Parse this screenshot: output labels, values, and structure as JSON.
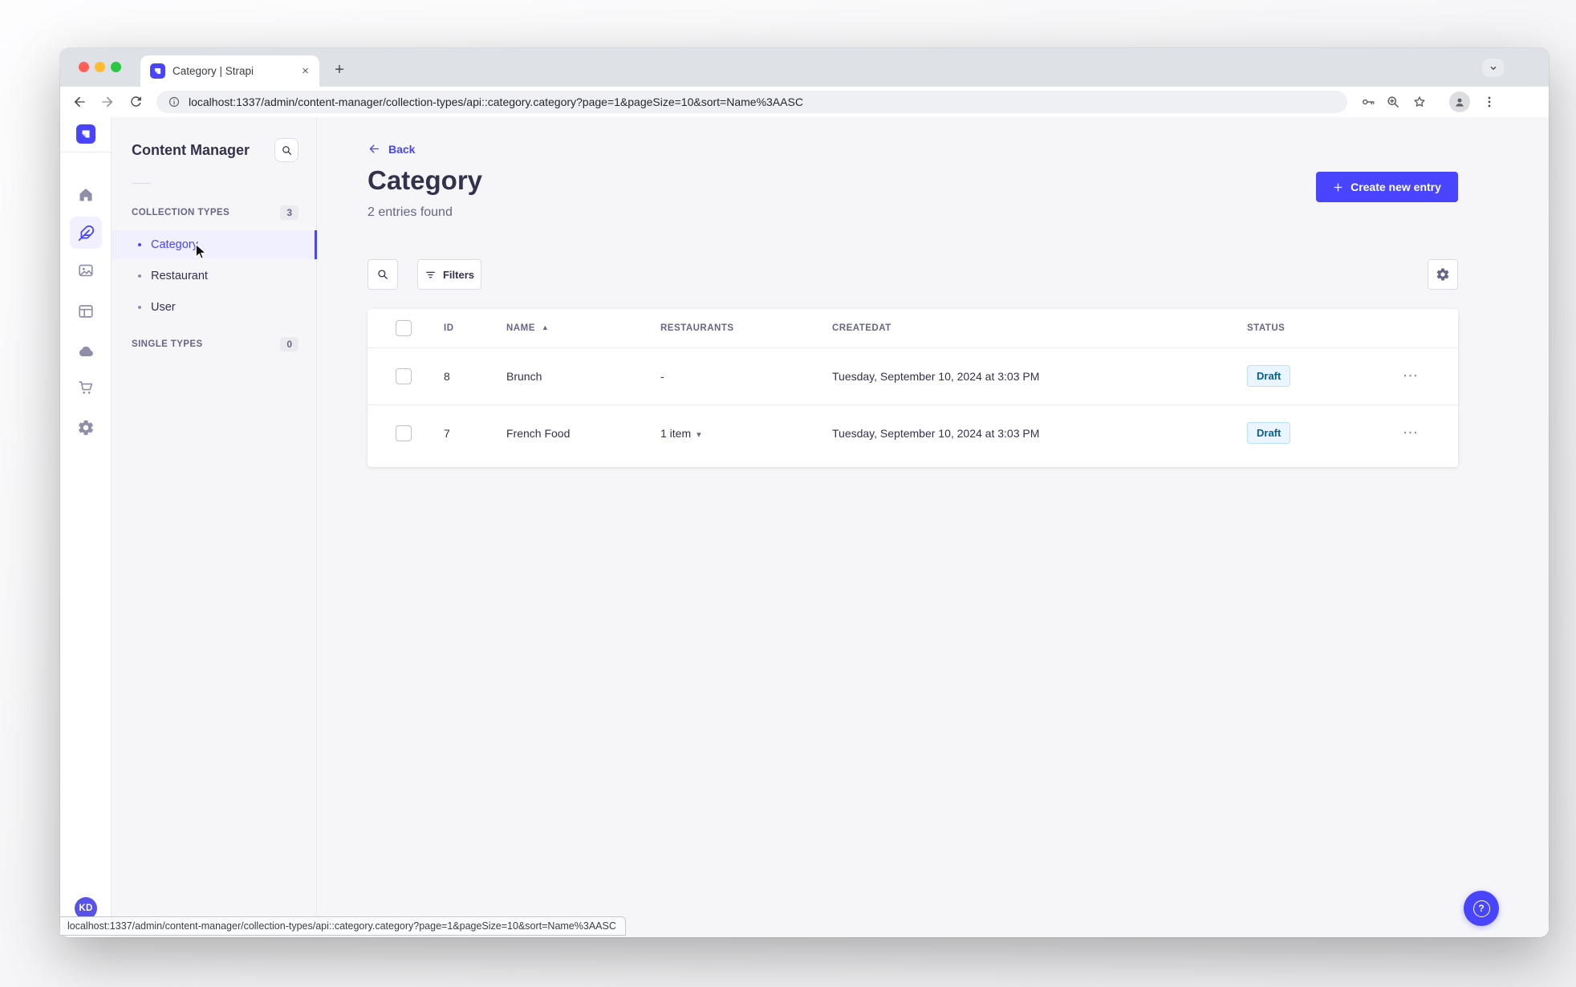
{
  "browser": {
    "tab_title": "Category | Strapi",
    "url": "localhost:1337/admin/content-manager/collection-types/api::category.category?page=1&pageSize=10&sort=Name%3AASC",
    "status_url": "localhost:1337/admin/content-manager/collection-types/api::category.category?page=1&pageSize=10&sort=Name%3AASC"
  },
  "icons": {
    "close_tab": "×",
    "new_tab": "+",
    "sort_asc": "▲",
    "caret_down": "▾",
    "more": "⋯",
    "help": "?"
  },
  "user": {
    "initials": "KD"
  },
  "subnav": {
    "title": "Content Manager",
    "sections": {
      "collection": {
        "label": "COLLECTION TYPES",
        "badge": "3"
      },
      "single": {
        "label": "SINGLE TYPES",
        "badge": "0"
      }
    },
    "items": [
      "Category",
      "Restaurant",
      "User"
    ]
  },
  "main": {
    "back_label": "Back",
    "title": "Category",
    "subtitle": "2 entries found",
    "create_button": "Create new entry",
    "filters_button": "Filters",
    "table": {
      "headers": {
        "id": "ID",
        "name": "NAME",
        "restaurants": "RESTAURANTS",
        "createdat": "CREATEDAT",
        "status": "STATUS"
      },
      "rows": [
        {
          "id": "8",
          "name": "Brunch",
          "restaurants": "-",
          "created_at": "Tuesday, September 10, 2024 at 3:03 PM",
          "status": "Draft"
        },
        {
          "id": "7",
          "name": "French Food",
          "restaurants": "1 item",
          "created_at": "Tuesday, September 10, 2024 at 3:03 PM",
          "status": "Draft"
        }
      ]
    }
  },
  "colors": {
    "primary": "#4945ff",
    "primary_light_bg": "#f0f0ff",
    "draft_bg": "#eaf5ff",
    "draft_border": "#b8e1ff",
    "draft_text": "#006096",
    "app_bg": "#f6f6f9"
  }
}
